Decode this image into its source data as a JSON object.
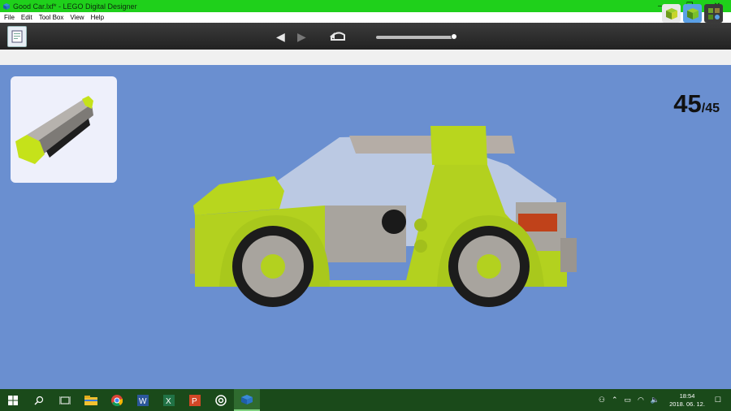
{
  "window": {
    "title": "Good Car.lxf* - LEGO Digital Designer",
    "minimize_glyph": "—",
    "restore_glyph": "❐",
    "close_glyph": "✕"
  },
  "menu": [
    "File",
    "Edit",
    "Tool Box",
    "View",
    "Help"
  ],
  "toolbar": {
    "doc_icon": "building-guide-document-icon",
    "prev_glyph": "◀",
    "next_glyph": "▶",
    "undo_icon": "back-to-start-icon",
    "step_progress": 1.0,
    "mode_buttons": [
      "build-mode-icon",
      "view-mode-icon",
      "building-guide-mode-icon"
    ]
  },
  "viewport": {
    "part_card_icon": "current-brick-preview",
    "step_current": "45",
    "step_total": "/45",
    "model": "lime-green-lego-car"
  },
  "colors": {
    "titlebar": "#1fd01b",
    "viewport_bg": "#6a8fd0",
    "car_lime": "#b3d11f",
    "car_gray": "#a8a49e",
    "taskbar": "#1a4a1a"
  },
  "taskbar": {
    "apps": [
      "windows-start-icon",
      "search-icon",
      "task-view-icon",
      "file-explorer-icon",
      "chrome-icon",
      "word-icon",
      "excel-icon",
      "powerpoint-icon",
      "groove-icon",
      "lego-digital-designer-icon"
    ],
    "time": "18:54",
    "date": "2018. 06. 12."
  }
}
